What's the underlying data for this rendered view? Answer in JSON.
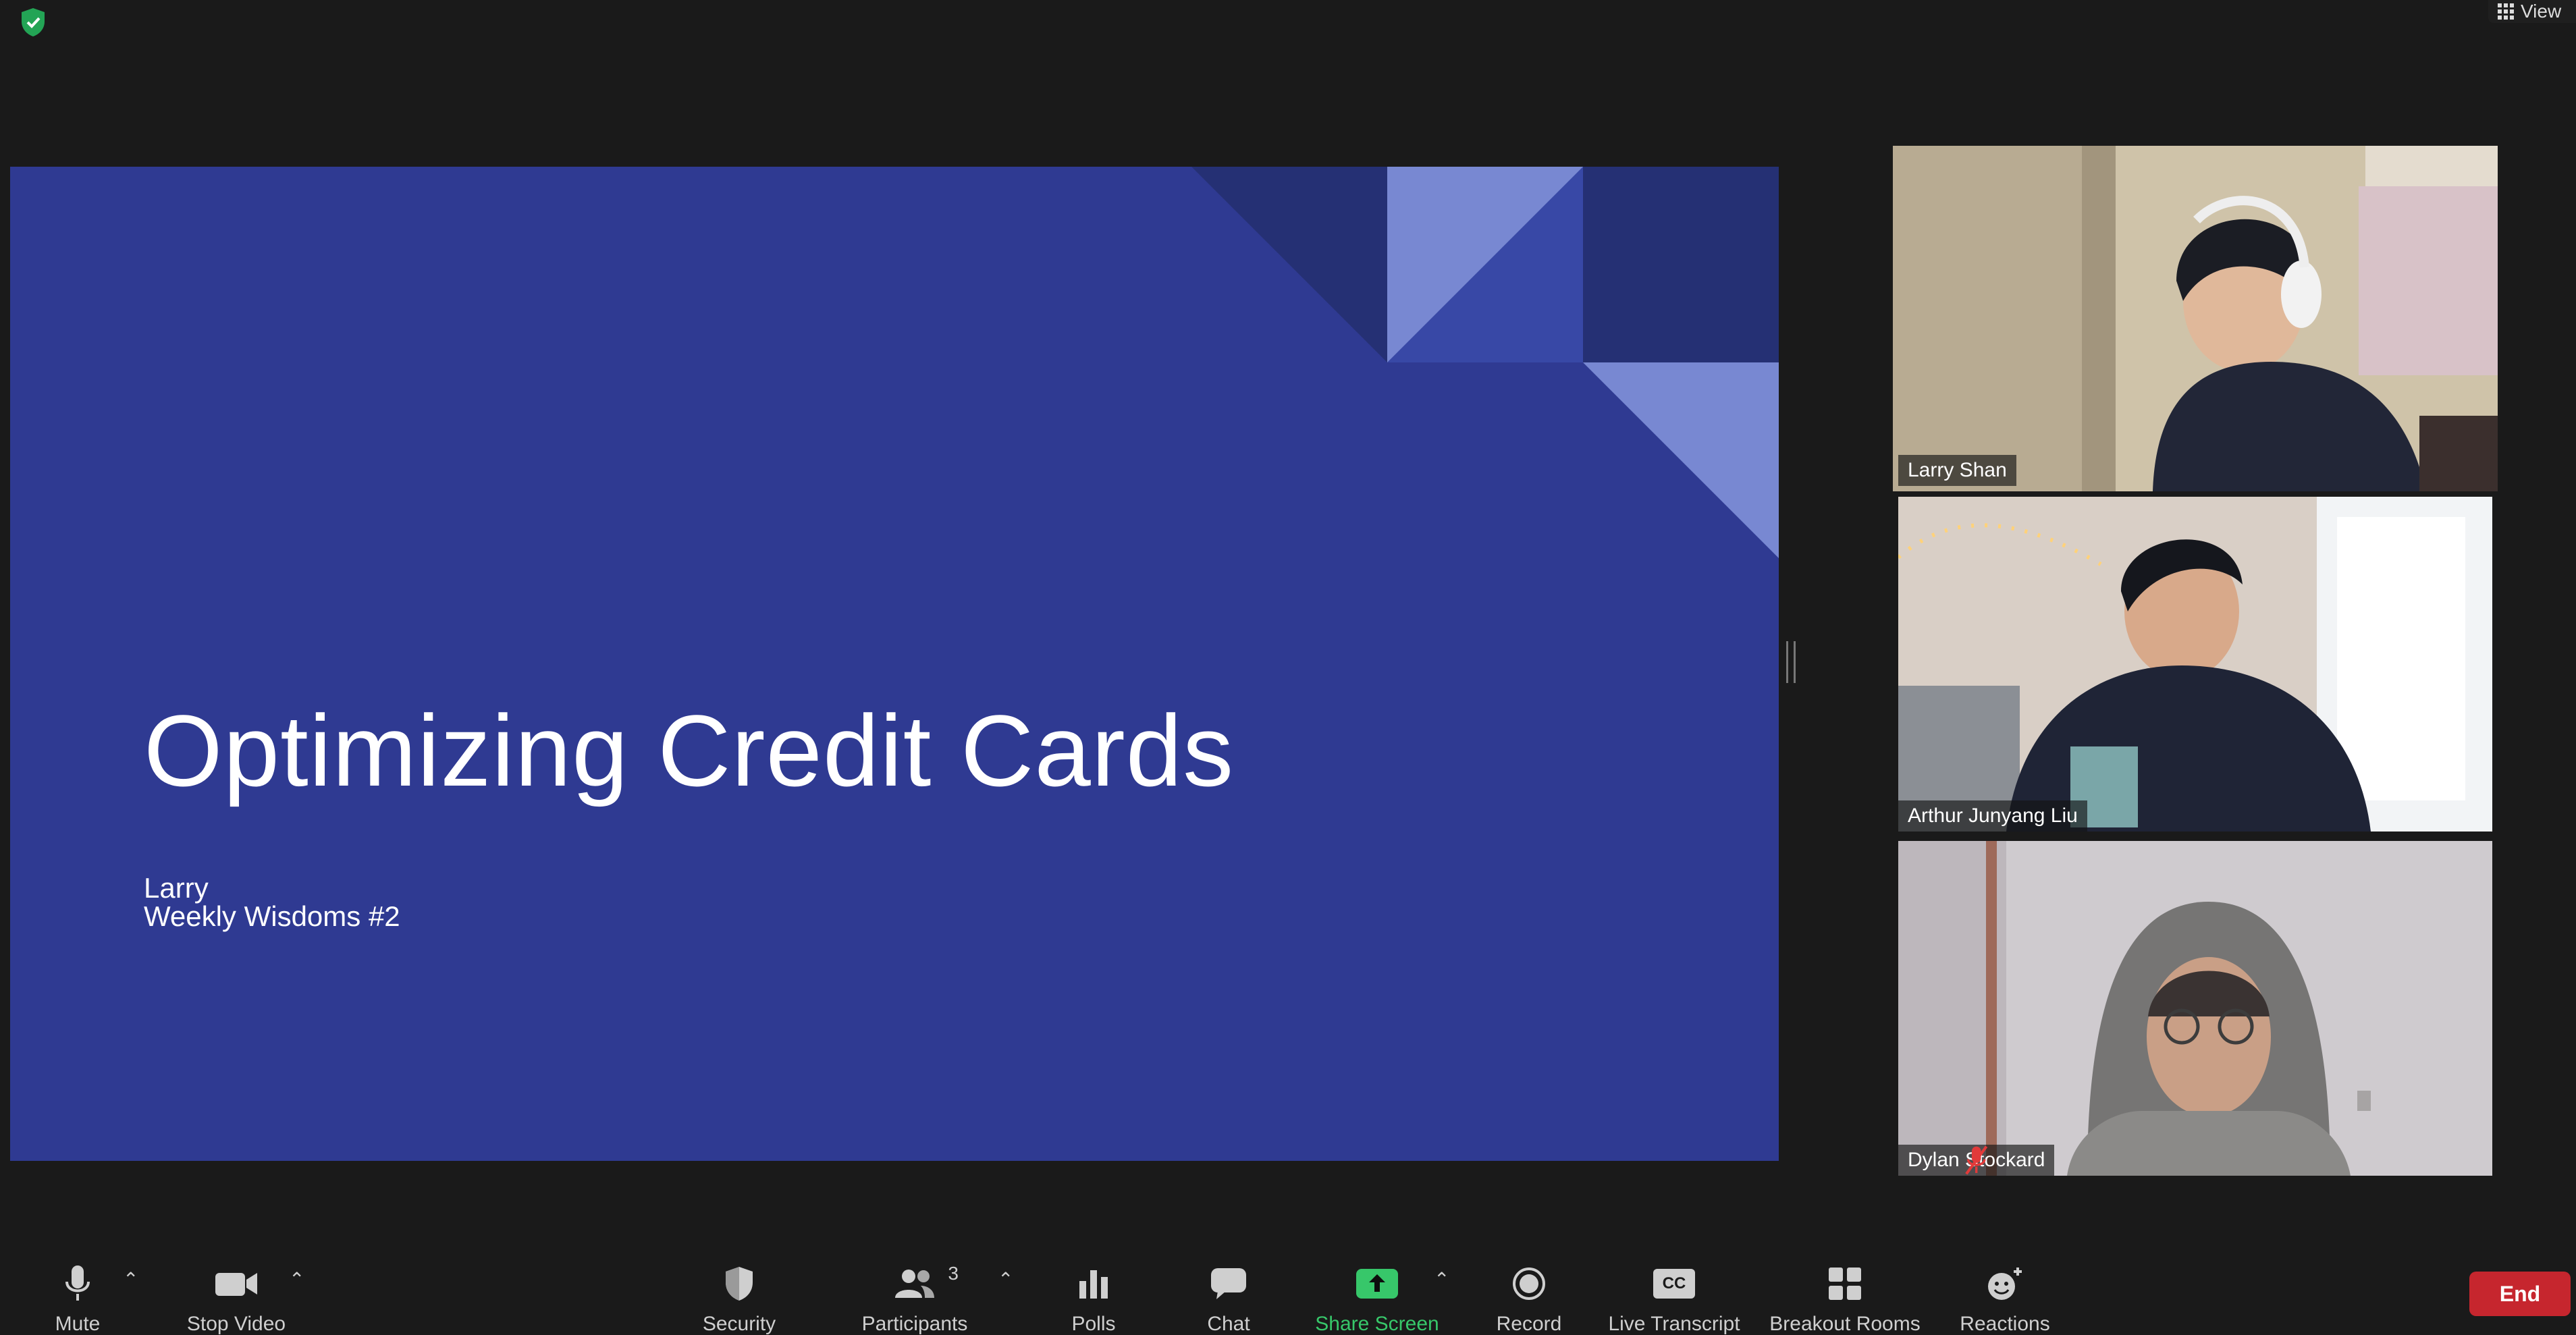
{
  "window": {
    "view_label": "View"
  },
  "slide": {
    "title": "Optimizing Credit Cards",
    "presenter": "Larry",
    "series": "Weekly Wisdoms #2",
    "colors": {
      "background": "#2f3a92",
      "dark": "#253074",
      "light": "#7888d2",
      "mid": "#3848a6"
    }
  },
  "participants": [
    {
      "name": "Larry Shan",
      "active_speaker": true,
      "muted": false
    },
    {
      "name": "Arthur Junyang Liu",
      "active_speaker": false,
      "muted": false
    },
    {
      "name": "Dylan Stockard",
      "active_speaker": false,
      "muted": true
    }
  ],
  "toolbar": {
    "mute": "Mute",
    "stop_video": "Stop Video",
    "security": "Security",
    "participants": "Participants",
    "participants_count": "3",
    "polls": "Polls",
    "chat": "Chat",
    "share_screen": "Share Screen",
    "record": "Record",
    "live_transcript": "Live Transcript",
    "live_transcript_icon_text": "CC",
    "breakout_rooms": "Breakout Rooms",
    "reactions": "Reactions",
    "end": "End"
  },
  "colors": {
    "accent_green": "#37c76a",
    "active_speaker_border": "#d6e86a",
    "end_red": "#c6262e"
  }
}
